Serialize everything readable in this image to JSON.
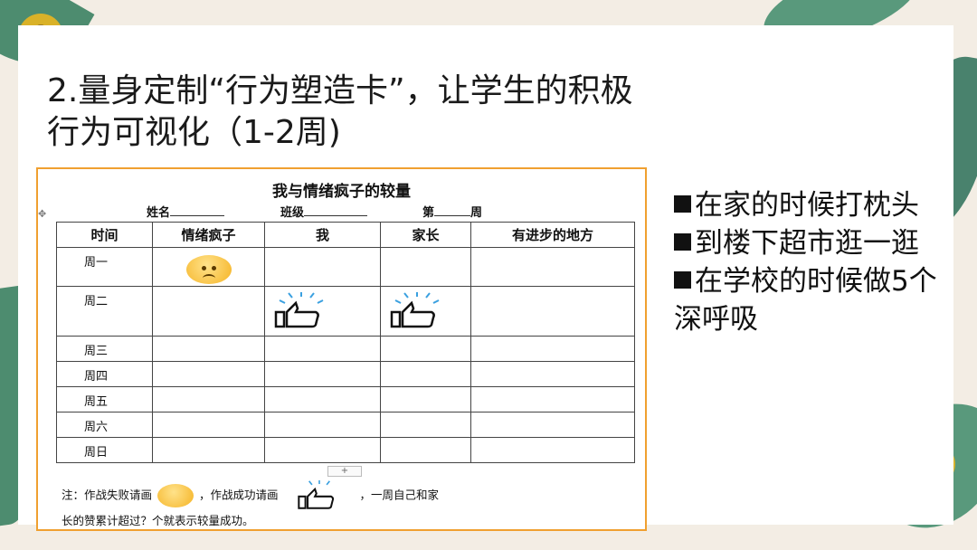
{
  "slide": {
    "title_line1": "2.量身定制“行为塑造卡”，让学生的积极",
    "title_line2": "行为可视化（1-2周)"
  },
  "card": {
    "heading": "我与情绪疯子的较量",
    "name_label": "姓名",
    "class_label": "班级",
    "week_prefix": "第",
    "week_suffix": "周",
    "columns": [
      "时间",
      "情绪疯子",
      "我",
      "家长",
      "有进步的地方"
    ],
    "rows": [
      {
        "day": "周一",
        "emotion": "sad-face-icon",
        "me": "",
        "parent": ""
      },
      {
        "day": "周二",
        "emotion": "",
        "me": "thumbs-up-icon",
        "parent": "thumbs-up-icon"
      },
      {
        "day": "周三",
        "emotion": "",
        "me": "",
        "parent": ""
      },
      {
        "day": "周四",
        "emotion": "",
        "me": "",
        "parent": ""
      },
      {
        "day": "周五",
        "emotion": "",
        "me": "",
        "parent": ""
      },
      {
        "day": "周六",
        "emotion": "",
        "me": "",
        "parent": ""
      },
      {
        "day": "周日",
        "emotion": "",
        "me": "",
        "parent": ""
      }
    ],
    "note_part1": "注：作战失败请画",
    "note_part2": "，作战成功请画",
    "note_part3": "，一周自己和家",
    "note_line2": "长的赞累计超过？个就表示较量成功。",
    "add_button": "+",
    "move_handle": "✥"
  },
  "bullets": [
    "在家的时候打枕头",
    "到楼下超市逛一逛",
    "在学校的时候做5个深呼吸"
  ],
  "colors": {
    "card_border": "#f0a030",
    "text": "#111111"
  }
}
